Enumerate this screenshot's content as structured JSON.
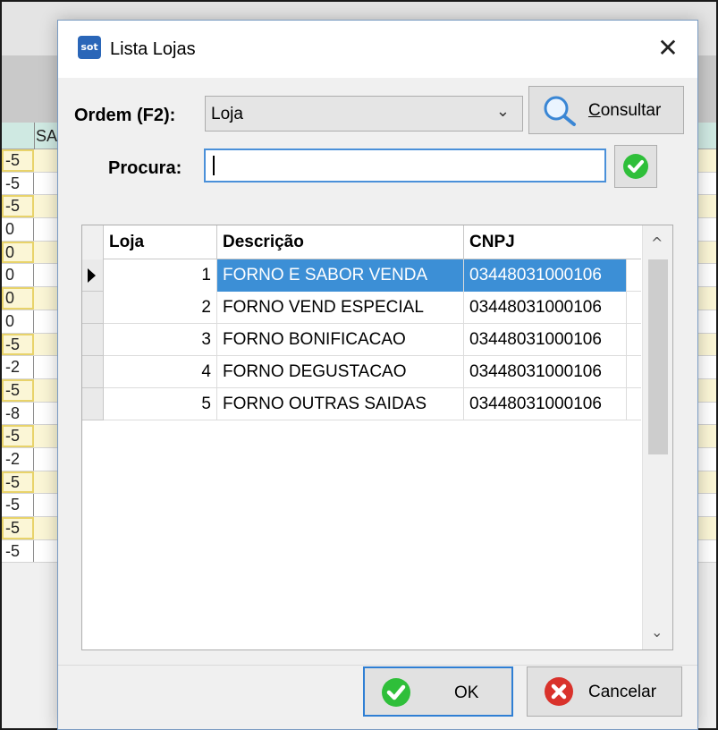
{
  "background": {
    "column_header": "SA",
    "row_values": [
      "-5",
      "-5",
      "-5",
      "0",
      "0",
      "0",
      "0",
      "0",
      "-5",
      "-2",
      "-5",
      "-8",
      "-5",
      "-2",
      "-5",
      "-5",
      "-5",
      "-5"
    ]
  },
  "dialog": {
    "title": "Lista Lojas",
    "app_icon_text": "sot",
    "order": {
      "label": "Ordem (F2):",
      "selected": "Loja"
    },
    "consultar": {
      "label_first": "C",
      "label_rest": "onsultar"
    },
    "search": {
      "label": "Procura:",
      "value": ""
    },
    "grid": {
      "columns": [
        "Loja",
        "Descrição",
        "CNPJ"
      ],
      "rows": [
        {
          "loja": "1",
          "descricao": "FORNO E SABOR VENDA",
          "cnpj": "03448031000106"
        },
        {
          "loja": "2",
          "descricao": "FORNO VEND  ESPECIAL",
          "cnpj": "03448031000106"
        },
        {
          "loja": "3",
          "descricao": "FORNO BONIFICACAO",
          "cnpj": "03448031000106"
        },
        {
          "loja": "4",
          "descricao": "FORNO DEGUSTACAO",
          "cnpj": "03448031000106"
        },
        {
          "loja": "5",
          "descricao": "FORNO OUTRAS SAIDAS",
          "cnpj": "03448031000106"
        }
      ],
      "selected_index": 0
    },
    "ok_label": "OK",
    "cancel_label": "Cancelar"
  },
  "colors": {
    "selection": "#3c8fd6",
    "ok_green": "#2fbf3a",
    "cancel_red": "#d9322b"
  }
}
